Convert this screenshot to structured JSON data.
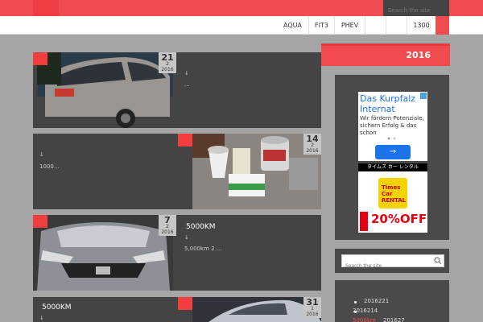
{
  "header": {
    "search_placeholder": "Search the site",
    "nav": [
      "AQUA",
      "FIT3",
      "PHEV",
      "",
      "",
      "1300"
    ]
  },
  "posts": [
    {
      "day": "21",
      "month": "2",
      "year": "2016",
      "meta": "↓",
      "excerpt": "..."
    },
    {
      "day": "14",
      "month": "2",
      "year": "2016",
      "meta": "↓",
      "excerpt": "1000..."
    },
    {
      "day": "7",
      "month": "2",
      "year": "2016",
      "title": "5000KM",
      "meta": "↓",
      "excerpt": "5,000km 2 ..."
    },
    {
      "day": "31",
      "month": "1",
      "year": "2016",
      "title": "5000KM",
      "meta": "↓"
    }
  ],
  "sidebar": {
    "heading": "2016",
    "ad1": {
      "headline": "Das Kurpfalz Internat",
      "text": "Wir fördern Potenziale, sichern Erfolg & das schon"
    },
    "ad2": {
      "header": "タイムズ カー レンタル",
      "brand": "Times Car RENTAL",
      "promo": "20%OFF!"
    },
    "search_placeholder": "Search the site",
    "archives": [
      "2016221",
      "2016214",
      "5000km",
      "201627"
    ]
  },
  "colors": {
    "accent": "#f04b4f",
    "panel": "#444444",
    "page": "#a5a5a5"
  }
}
